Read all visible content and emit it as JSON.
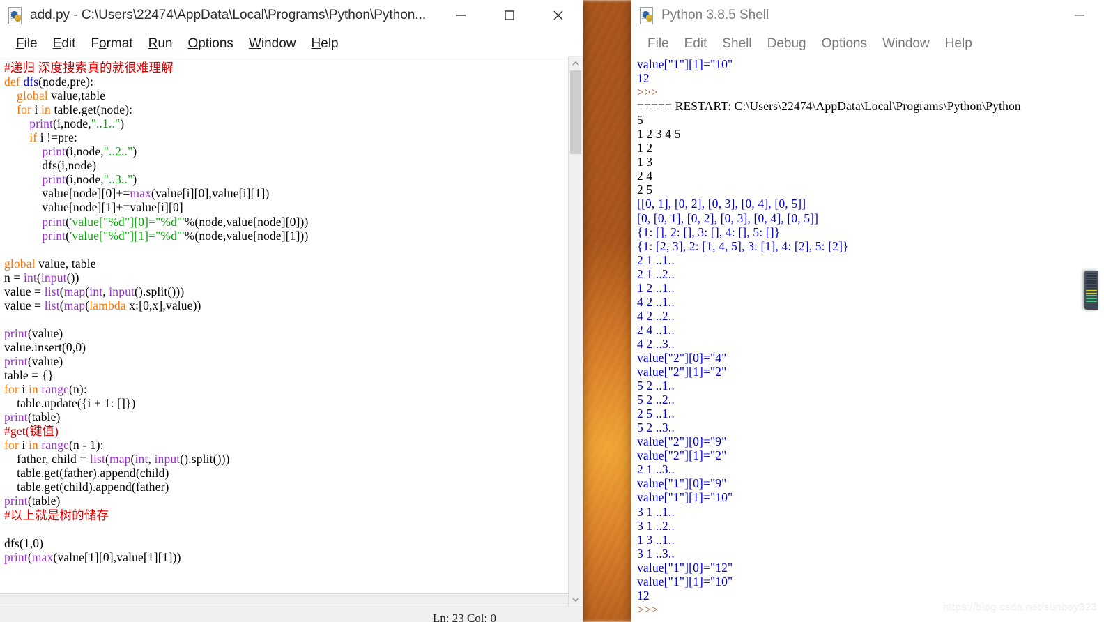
{
  "editor_window": {
    "title": "add.py - C:\\Users\\22474\\AppData\\Local\\Programs\\Python\\Python...",
    "icon": "python-file-icon",
    "caption": {
      "minimize": "minimize-icon",
      "maximize": "maximize-icon",
      "close": "close-icon"
    },
    "menu": [
      {
        "label": "File",
        "accel": "F"
      },
      {
        "label": "Edit",
        "accel": "E"
      },
      {
        "label": "Format",
        "accel": "o"
      },
      {
        "label": "Run",
        "accel": "R"
      },
      {
        "label": "Options",
        "accel": "O"
      },
      {
        "label": "Window",
        "accel": "W"
      },
      {
        "label": "Help",
        "accel": "H"
      }
    ],
    "status": "Ln: 23  Col: 0",
    "scrollbar": {
      "up_arrow": "chevron-up-icon",
      "down_arrow": "chevron-down-icon"
    },
    "code_lines": [
      [
        {
          "t": "#递归 深度搜索真的就很难理解",
          "c": "cmt"
        }
      ],
      [
        {
          "t": "def ",
          "c": "kw"
        },
        {
          "t": "dfs",
          "c": "fn"
        },
        {
          "t": "(node,pre):",
          "c": ""
        }
      ],
      [
        {
          "t": "    ",
          "c": ""
        },
        {
          "t": "global ",
          "c": "kw"
        },
        {
          "t": "value,table",
          "c": ""
        }
      ],
      [
        {
          "t": "    ",
          "c": ""
        },
        {
          "t": "for ",
          "c": "kw"
        },
        {
          "t": "i ",
          "c": ""
        },
        {
          "t": "in ",
          "c": "kw"
        },
        {
          "t": "table.get(node):",
          "c": ""
        }
      ],
      [
        {
          "t": "        ",
          "c": ""
        },
        {
          "t": "print",
          "c": "bi"
        },
        {
          "t": "(i,node,",
          "c": ""
        },
        {
          "t": "\"..1..\"",
          "c": "str"
        },
        {
          "t": ")",
          "c": ""
        }
      ],
      [
        {
          "t": "        ",
          "c": ""
        },
        {
          "t": "if ",
          "c": "kw"
        },
        {
          "t": "i !=pre:",
          "c": ""
        }
      ],
      [
        {
          "t": "            ",
          "c": ""
        },
        {
          "t": "print",
          "c": "bi"
        },
        {
          "t": "(i,node,",
          "c": ""
        },
        {
          "t": "\"..2..\"",
          "c": "str"
        },
        {
          "t": ")",
          "c": ""
        }
      ],
      [
        {
          "t": "            dfs(i,node)",
          "c": ""
        }
      ],
      [
        {
          "t": "            ",
          "c": ""
        },
        {
          "t": "print",
          "c": "bi"
        },
        {
          "t": "(i,node,",
          "c": ""
        },
        {
          "t": "\"..3..\"",
          "c": "str"
        },
        {
          "t": ")",
          "c": ""
        }
      ],
      [
        {
          "t": "            value[node][0]+=",
          "c": ""
        },
        {
          "t": "max",
          "c": "bi"
        },
        {
          "t": "(value[i][0],value[i][1])",
          "c": ""
        }
      ],
      [
        {
          "t": "            value[node][1]+=value[i][0]",
          "c": ""
        }
      ],
      [
        {
          "t": "            ",
          "c": ""
        },
        {
          "t": "print",
          "c": "bi"
        },
        {
          "t": "(",
          "c": ""
        },
        {
          "t": "'value[\"%d\"][0]=\"%d\"'",
          "c": "str"
        },
        {
          "t": "%(node,value[node][0]))",
          "c": ""
        }
      ],
      [
        {
          "t": "            ",
          "c": ""
        },
        {
          "t": "print",
          "c": "bi"
        },
        {
          "t": "(",
          "c": ""
        },
        {
          "t": "'value[\"%d\"][1]=\"%d\"'",
          "c": "str"
        },
        {
          "t": "%(node,value[node][1]))",
          "c": ""
        }
      ],
      [
        {
          "t": "",
          "c": ""
        }
      ],
      [
        {
          "t": "global ",
          "c": "kw"
        },
        {
          "t": "value, table",
          "c": ""
        }
      ],
      [
        {
          "t": "n = ",
          "c": ""
        },
        {
          "t": "int",
          "c": "bi"
        },
        {
          "t": "(",
          "c": ""
        },
        {
          "t": "input",
          "c": "bi"
        },
        {
          "t": "())",
          "c": ""
        }
      ],
      [
        {
          "t": "value = ",
          "c": ""
        },
        {
          "t": "list",
          "c": "bi"
        },
        {
          "t": "(",
          "c": ""
        },
        {
          "t": "map",
          "c": "bi"
        },
        {
          "t": "(",
          "c": ""
        },
        {
          "t": "int",
          "c": "bi"
        },
        {
          "t": ", ",
          "c": ""
        },
        {
          "t": "input",
          "c": "bi"
        },
        {
          "t": "().split()))",
          "c": ""
        }
      ],
      [
        {
          "t": "value = ",
          "c": ""
        },
        {
          "t": "list",
          "c": "bi"
        },
        {
          "t": "(",
          "c": ""
        },
        {
          "t": "map",
          "c": "bi"
        },
        {
          "t": "(",
          "c": ""
        },
        {
          "t": "lambda ",
          "c": "kw"
        },
        {
          "t": "x:[0,x],value))",
          "c": ""
        }
      ],
      [
        {
          "t": "",
          "c": ""
        }
      ],
      [
        {
          "t": "print",
          "c": "bi"
        },
        {
          "t": "(value)",
          "c": ""
        }
      ],
      [
        {
          "t": "value.insert(0,0)",
          "c": ""
        }
      ],
      [
        {
          "t": "print",
          "c": "bi"
        },
        {
          "t": "(value)",
          "c": ""
        }
      ],
      [
        {
          "t": "table = {}",
          "c": ""
        }
      ],
      [
        {
          "t": "for ",
          "c": "kw"
        },
        {
          "t": "i ",
          "c": ""
        },
        {
          "t": "in ",
          "c": "kw"
        },
        {
          "t": "range",
          "c": "bi"
        },
        {
          "t": "(n):",
          "c": ""
        }
      ],
      [
        {
          "t": "    table.update({i + 1: []})",
          "c": ""
        }
      ],
      [
        {
          "t": "print",
          "c": "bi"
        },
        {
          "t": "(table)",
          "c": ""
        }
      ],
      [
        {
          "t": "#get(键值)",
          "c": "cmt"
        }
      ],
      [
        {
          "t": "for ",
          "c": "kw"
        },
        {
          "t": "i ",
          "c": ""
        },
        {
          "t": "in ",
          "c": "kw"
        },
        {
          "t": "range",
          "c": "bi"
        },
        {
          "t": "(n - 1):",
          "c": ""
        }
      ],
      [
        {
          "t": "    father, child = ",
          "c": ""
        },
        {
          "t": "list",
          "c": "bi"
        },
        {
          "t": "(",
          "c": ""
        },
        {
          "t": "map",
          "c": "bi"
        },
        {
          "t": "(",
          "c": ""
        },
        {
          "t": "int",
          "c": "bi"
        },
        {
          "t": ", ",
          "c": ""
        },
        {
          "t": "input",
          "c": "bi"
        },
        {
          "t": "().split()))",
          "c": ""
        }
      ],
      [
        {
          "t": "    table.get(father).append(child)",
          "c": ""
        }
      ],
      [
        {
          "t": "    table.get(child).append(father)",
          "c": ""
        }
      ],
      [
        {
          "t": "print",
          "c": "bi"
        },
        {
          "t": "(table)",
          "c": ""
        }
      ],
      [
        {
          "t": "#以上就是树的储存",
          "c": "cmt"
        }
      ],
      [
        {
          "t": "",
          "c": ""
        }
      ],
      [
        {
          "t": "dfs(1,0)",
          "c": ""
        }
      ],
      [
        {
          "t": "print",
          "c": "bi"
        },
        {
          "t": "(",
          "c": ""
        },
        {
          "t": "max",
          "c": "bi"
        },
        {
          "t": "(value[1][0],value[1][1]))",
          "c": ""
        }
      ]
    ]
  },
  "shell_window": {
    "title": "Python 3.8.5 Shell",
    "icon": "python-file-icon",
    "caption": {
      "minimize": "minimize-icon"
    },
    "menu": [
      {
        "label": "File"
      },
      {
        "label": "Edit"
      },
      {
        "label": "Shell"
      },
      {
        "label": "Debug"
      },
      {
        "label": "Options"
      },
      {
        "label": "Window"
      },
      {
        "label": "Help"
      }
    ],
    "output_lines": [
      {
        "t": "value[\"1\"][1]=\"10\"",
        "c": "sout"
      },
      {
        "t": "12",
        "c": "sout"
      },
      {
        "t": ">>>",
        "c": "sprompt"
      },
      {
        "t": "===== RESTART: C:\\Users\\22474\\AppData\\Local\\Programs\\Python\\Python",
        "c": "sblack"
      },
      {
        "t": "5",
        "c": "sblack"
      },
      {
        "t": "1 2 3 4 5",
        "c": "sblack"
      },
      {
        "t": "1 2",
        "c": "sblack"
      },
      {
        "t": "1 3",
        "c": "sblack"
      },
      {
        "t": "2 4",
        "c": "sblack"
      },
      {
        "t": "2 5",
        "c": "sblack"
      },
      {
        "t": "[[0, 1], [0, 2], [0, 3], [0, 4], [0, 5]]",
        "c": "sout"
      },
      {
        "t": "[0, [0, 1], [0, 2], [0, 3], [0, 4], [0, 5]]",
        "c": "sout"
      },
      {
        "t": "{1: [], 2: [], 3: [], 4: [], 5: []}",
        "c": "sout"
      },
      {
        "t": "{1: [2, 3], 2: [1, 4, 5], 3: [1], 4: [2], 5: [2]}",
        "c": "sout"
      },
      {
        "t": "2 1 ..1..",
        "c": "sout"
      },
      {
        "t": "2 1 ..2..",
        "c": "sout"
      },
      {
        "t": "1 2 ..1..",
        "c": "sout"
      },
      {
        "t": "4 2 ..1..",
        "c": "sout"
      },
      {
        "t": "4 2 ..2..",
        "c": "sout"
      },
      {
        "t": "2 4 ..1..",
        "c": "sout"
      },
      {
        "t": "4 2 ..3..",
        "c": "sout"
      },
      {
        "t": "value[\"2\"][0]=\"4\"",
        "c": "sout"
      },
      {
        "t": "value[\"2\"][1]=\"2\"",
        "c": "sout"
      },
      {
        "t": "5 2 ..1..",
        "c": "sout"
      },
      {
        "t": "5 2 ..2..",
        "c": "sout"
      },
      {
        "t": "2 5 ..1..",
        "c": "sout"
      },
      {
        "t": "5 2 ..3..",
        "c": "sout"
      },
      {
        "t": "value[\"2\"][0]=\"9\"",
        "c": "sout"
      },
      {
        "t": "value[\"2\"][1]=\"2\"",
        "c": "sout"
      },
      {
        "t": "2 1 ..3..",
        "c": "sout"
      },
      {
        "t": "value[\"1\"][0]=\"9\"",
        "c": "sout"
      },
      {
        "t": "value[\"1\"][1]=\"10\"",
        "c": "sout"
      },
      {
        "t": "3 1 ..1..",
        "c": "sout"
      },
      {
        "t": "3 1 ..2..",
        "c": "sout"
      },
      {
        "t": "1 3 ..1..",
        "c": "sout"
      },
      {
        "t": "3 1 ..3..",
        "c": "sout"
      },
      {
        "t": "value[\"1\"][0]=\"12\"",
        "c": "sout"
      },
      {
        "t": "value[\"1\"][1]=\"10\"",
        "c": "sout"
      },
      {
        "t": "12",
        "c": "sout"
      },
      {
        "t": ">>>",
        "c": "sprompt"
      }
    ]
  },
  "desktop": {
    "gadget_name": "system-monitor-gadget",
    "watermark": "https://blog.csdn.net/sunboy323"
  },
  "colors": {
    "keyword": "#ff7700",
    "builtin": "#9933cc",
    "string": "#00aa00",
    "comment": "#dd0000",
    "definition": "#0000cc",
    "stdout": "#0000cc",
    "prompt": "#b05a32"
  }
}
